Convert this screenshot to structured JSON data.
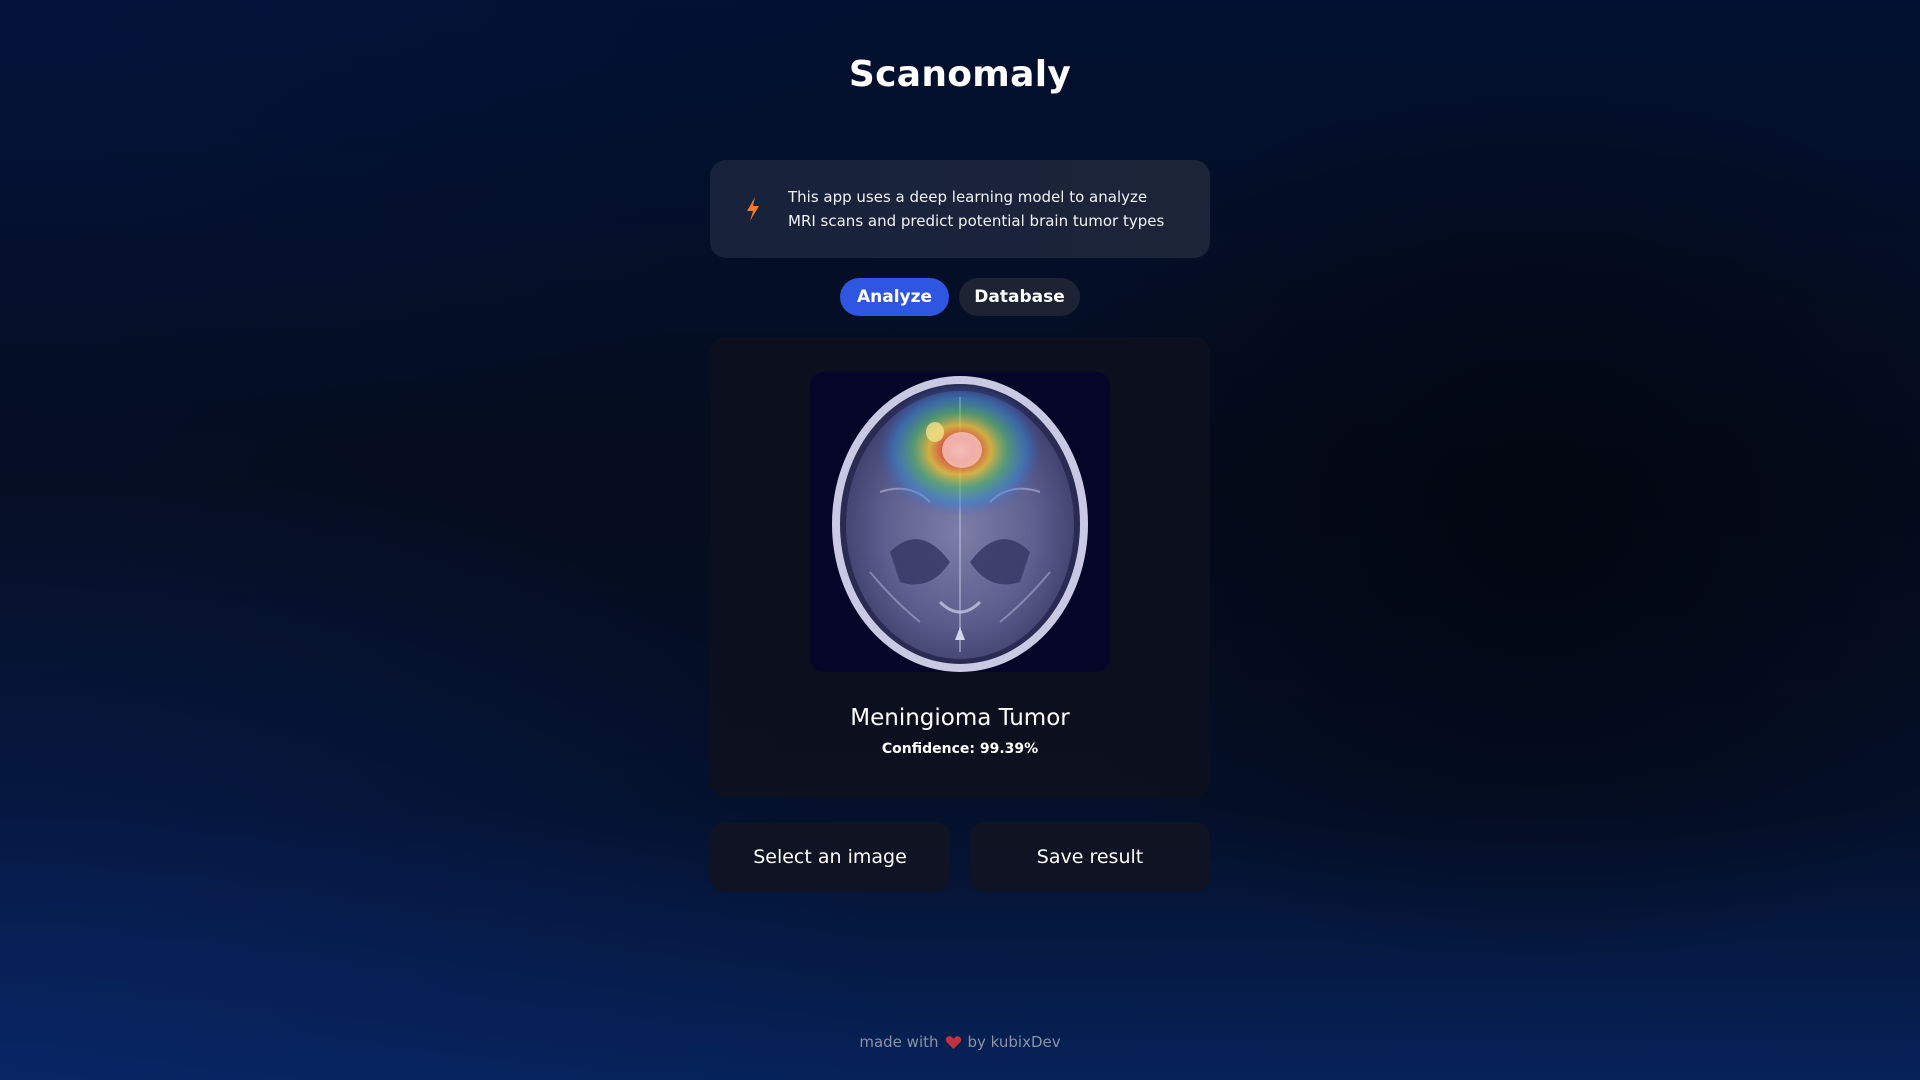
{
  "app": {
    "title": "Scanomaly"
  },
  "info": {
    "icon": "lightning-bolt-icon",
    "text": "This app uses a deep learning model to analyze MRI scans and predict potential brain tumor types",
    "icon_color": "#f07a2a"
  },
  "tabs": [
    {
      "label": "Analyze",
      "active": true
    },
    {
      "label": "Database",
      "active": false
    }
  ],
  "result": {
    "image_alt": "MRI scan with heatmap",
    "prediction": "Meningioma Tumor",
    "confidence": "Confidence: 99.39%"
  },
  "actions": {
    "select_label": "Select an image",
    "save_label": "Save result"
  },
  "footer": {
    "made_with": "made with",
    "by": "by kubixDev",
    "heart_color": "#c0303e"
  },
  "colors": {
    "accent": "#2f56e0",
    "card": "#0d111e"
  }
}
